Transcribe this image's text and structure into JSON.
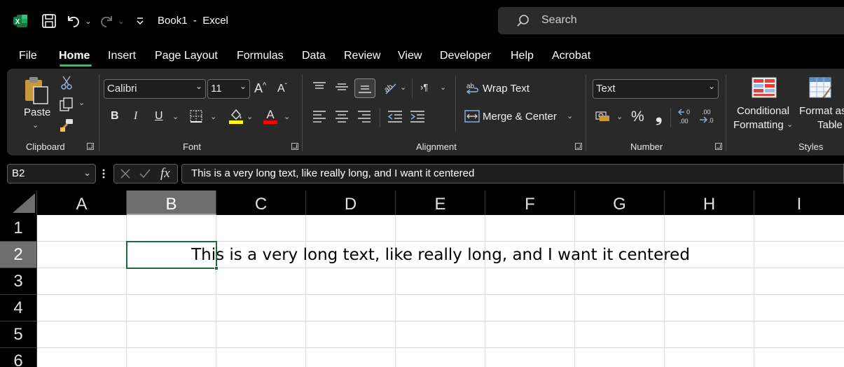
{
  "titlebar": {
    "app_icon": "excel-logo-icon",
    "title": "Book1  -  Excel",
    "search_placeholder": "Search"
  },
  "menu": {
    "tabs": [
      "File",
      "Home",
      "Insert",
      "Page Layout",
      "Formulas",
      "Data",
      "Review",
      "View",
      "Developer",
      "Help",
      "Acrobat"
    ],
    "active": "Home"
  },
  "ribbon": {
    "clipboard": {
      "label": "Clipboard",
      "paste": "Paste"
    },
    "font": {
      "label": "Font",
      "name": "Calibri",
      "size": "11",
      "highlight_color": "#ffff00",
      "font_color": "#ff0000"
    },
    "alignment": {
      "label": "Alignment",
      "wrap_text": "Wrap Text",
      "merge_center": "Merge & Center"
    },
    "number": {
      "label": "Number",
      "format": "Text",
      "percent": "%",
      "comma": "❟"
    },
    "styles": {
      "label": "Styles",
      "conditional_1": "Conditional",
      "conditional_2": "Formatting",
      "format_as_1": "Format as",
      "format_as_2": "Table"
    }
  },
  "formula_bar": {
    "name_box": "B2",
    "fx": "fx",
    "content": "This is a very long text, like really long, and I want it centered"
  },
  "grid": {
    "columns": [
      "A",
      "B",
      "C",
      "D",
      "E",
      "F",
      "G",
      "H",
      "I"
    ],
    "rows": [
      "1",
      "2",
      "3",
      "4",
      "5",
      "6"
    ],
    "selected_column": "B",
    "selected_row": "2",
    "cell_b2": "This is a very long text, like really long, and I want it centered"
  },
  "colors": {
    "accent": "#4caf78",
    "selection": "#1f6b3b"
  }
}
